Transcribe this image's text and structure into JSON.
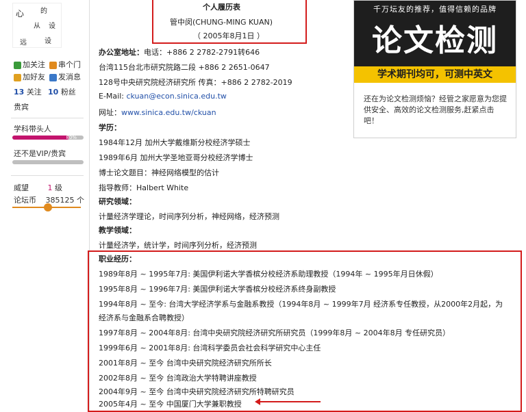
{
  "sidebar": {
    "follow": "加关注",
    "visit": "串个门",
    "add_friend": "加好友",
    "message": "发消息",
    "follow_count": "13",
    "follow_label": "关注",
    "fans_count": "10",
    "fans_label": "粉丝",
    "guest_label": "贵宾",
    "rank_label": "学科带头人",
    "rank_progress": 0.8,
    "rank_pct": "80%",
    "vip_label": "还不是VIP/贵宾",
    "prestige_label": "威望",
    "prestige_value": "1",
    "prestige_unit": "级",
    "coin_label": "论坛币",
    "coin_value": "385125",
    "coin_unit": "个"
  },
  "header": {
    "title": "个人履历表",
    "name": "管中闵(CHUNG-MING KUAN)",
    "date": "（ 2005年8月1日 ）"
  },
  "office": {
    "label": "办公室地址：",
    "line1": "电话：+886 2 2782-2791转646",
    "line2": "台湾115台北市研究院路二段 +886 2 2651-0647",
    "line3": "128号中央研究院经济研究所 传真：+886 2 2782-2019",
    "email_label": "E-Mail: ",
    "email": "ckuan@econ.sinica.edu.tw",
    "web_label": "网址：",
    "web": "www.sinica.edu.tw/ckuan"
  },
  "education": {
    "label": "学历：",
    "items": [
      "1984年12月 加州大学戴维斯分校经济学硕士",
      "1989年6月 加州大学圣地亚哥分校经济学博士",
      "博士论文题目：神经网络模型的估计",
      "指导教师：Halbert White"
    ]
  },
  "research": {
    "label": "研究领域：",
    "text": "计量经济学理论，时间序列分析，神经网络，经济预测"
  },
  "teaching": {
    "label": "教学领域：",
    "text": "计量经济学，统计学，时间序列分析，经济预测"
  },
  "career": {
    "label": "职业经历：",
    "items": [
      "1989年8月 ~ 1995年7月: 美国伊利诺大学香槟分校经济系助理教授（1994年 ~ 1995年月日休假）",
      "1995年8月 ~ 1996年7月: 美国伊利诺大学香槟分校经济系终身副教授",
      "1994年8月 ~ 至今: 台湾大学经济学系与金融系教授（1994年8月 ~ 1999年7月 经济系专任教授，从2000年2月起，为",
      "经济系与金融系合聘教授）",
      "1997年8月 ~ 2004年8月: 台湾中央研究院经济研究所研究员（1999年8月 ~ 2004年8月 专任研究员）",
      "1999年6月 ~ 2001年8月: 台湾科学委员会社会科学研究中心主任",
      "2001年8月 ~ 至今 台湾中央研究院经济研究所所长",
      "2002年8月 ~ 至今 台湾政治大学特聘讲座教授",
      "2004年9月 ~ 至今 台湾中央研究院经济研究所特聘研究员",
      "2005年4月 ~ 至今 中国厦门大学兼职教授"
    ]
  },
  "ad": {
    "slogan": "千万坛友的推荐，值得信赖的品牌",
    "big": "论文检测",
    "banner": "学术期刊均可，可测中英文",
    "text": "还在为论文检测烦恼？经管之家愿意为您提供安全、高效的论文检测服务,赶紧点击吧！"
  },
  "colors": {
    "red_box": "#d31b1b",
    "progress": "#c3146d",
    "ad_yellow": "#f4c200",
    "link": "#2250a8"
  }
}
